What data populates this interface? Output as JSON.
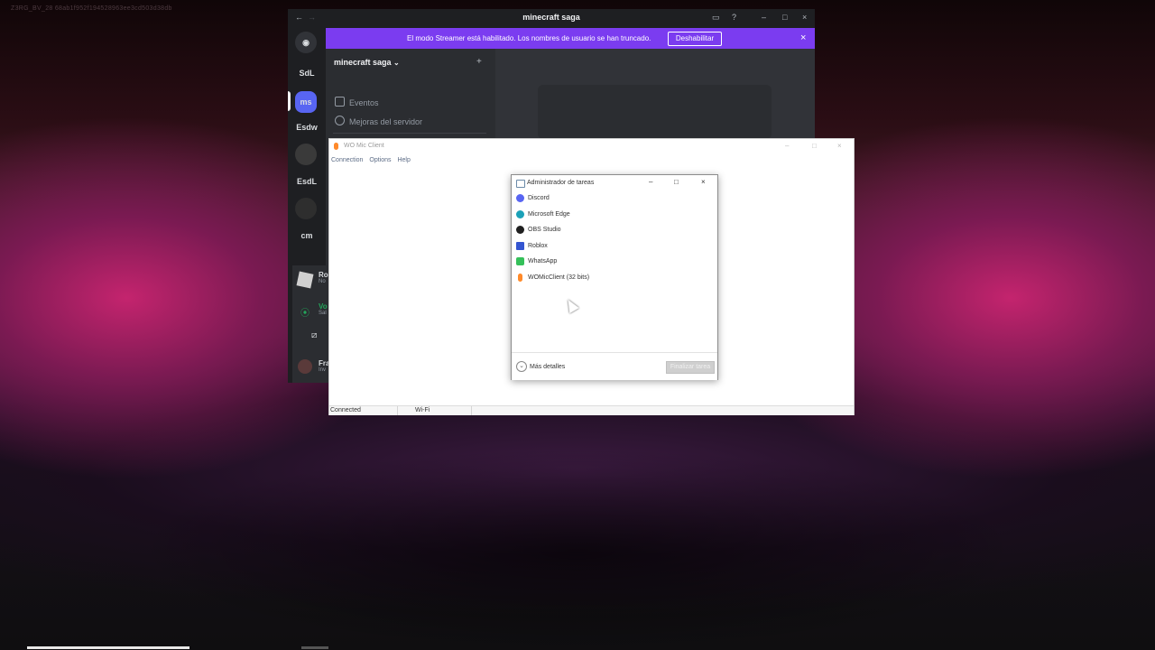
{
  "watermark": "Z3RG_BV_28    68ab1f952f194528963ee3cd503d38db",
  "discord": {
    "title": "minecraft saga",
    "banner_text": "El modo Streamer está habilitado. Los nombres de usuario se han truncado.",
    "banner_button": "Deshabilitar",
    "banner_close": "×",
    "nav_back": "←",
    "nav_forward": "→",
    "win_min": "–",
    "win_max": "□",
    "win_close": "×",
    "help": "?",
    "server_name": "minecraft saga",
    "channels": [
      "Eventos",
      "Mejoras del servidor"
    ],
    "guilds": [
      "SdL",
      "ms",
      "Esdw",
      "EsdL",
      "cm"
    ],
    "side_partial": [
      "Ro",
      "No",
      "Vo",
      "Sal",
      "Fra",
      "Inv"
    ]
  },
  "womic": {
    "title": "WO Mic Client",
    "menu": [
      "Connection",
      "Options",
      "Help"
    ],
    "status_connection": "Connected",
    "status_transport": "Wi-Fi",
    "win_min": "–",
    "win_max": "□",
    "win_close": "×"
  },
  "taskmanager": {
    "title": "Administrador de tareas",
    "apps": [
      {
        "name": "Discord",
        "color": "#5865f2"
      },
      {
        "name": "Microsoft Edge",
        "color": "#1ba1b8"
      },
      {
        "name": "OBS Studio",
        "color": "#202020"
      },
      {
        "name": "Roblox",
        "color": "#3455d1"
      },
      {
        "name": "WhatsApp",
        "color": "#35c05a"
      },
      {
        "name": "WOMicClient (32 bits)",
        "color": "#ff8a2a"
      }
    ],
    "more_details": "Más detalles",
    "end_task": "Finalizar tarea",
    "win_min": "–",
    "win_max": "□",
    "win_close": "×"
  }
}
